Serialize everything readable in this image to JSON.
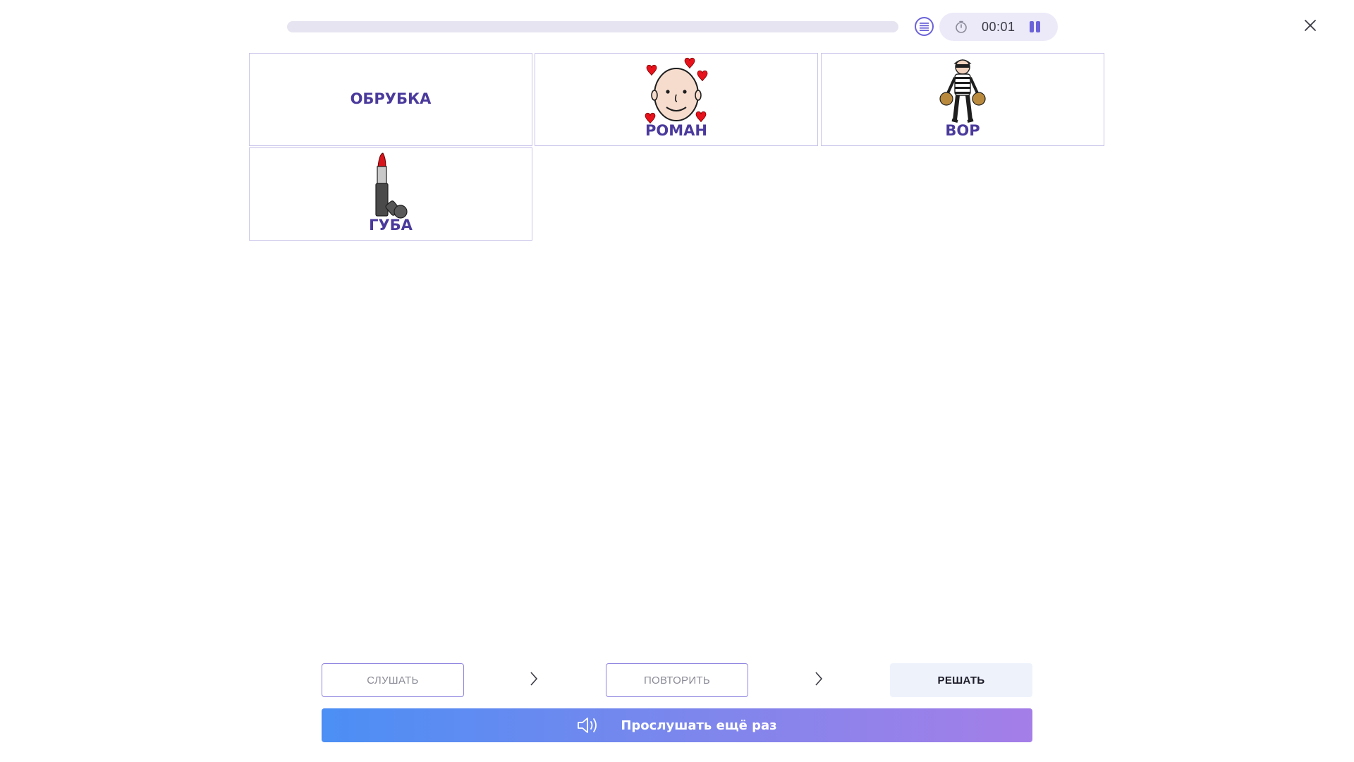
{
  "header": {
    "progress": 0,
    "timer": "00:01",
    "list_icon": "list-icon",
    "timer_icon": "stopwatch-icon",
    "pause_icon": "pause-icon",
    "close_icon": "close-icon"
  },
  "cards": [
    {
      "label": "ОБРУБКА",
      "image": null
    },
    {
      "label": "РОМАН",
      "image": "face-with-hearts"
    },
    {
      "label": "ВОР",
      "image": "thief"
    },
    {
      "label": "ГУБА",
      "image": "lipstick"
    }
  ],
  "steps": [
    {
      "label": "СЛУШАТЬ",
      "active": false
    },
    {
      "label": "ПОВТОРИТЬ",
      "active": false
    },
    {
      "label": "РЕШАТЬ",
      "active": true
    }
  ],
  "play_again": {
    "label": "Прослушать ещё раз",
    "icon": "speaker-icon"
  },
  "colors": {
    "accent": "#6b62d9",
    "card_text": "#4b3a9c",
    "gradient_start": "#4b8ff5",
    "gradient_end": "#a57ee8"
  }
}
